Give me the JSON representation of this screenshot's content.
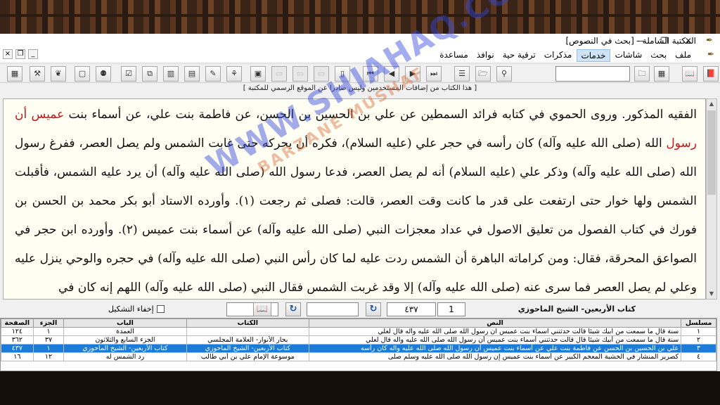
{
  "window": {
    "title": "المكتبة الشاملة - [بحث في النصوص]",
    "minimize": "—",
    "maximize": "❐",
    "close": "✕"
  },
  "menu": [
    "ملف",
    "بحث",
    "شاشات",
    "خدمات",
    "مذكرات",
    "ترقية حية",
    "نوافذ",
    "مساعدة"
  ],
  "menu_active": "خدمات",
  "notice": "[ هذا الكتاب من إضافات المستخدمين وليس صادرا عن الموقع الرسمي للمكتبة ]",
  "text": {
    "l1a": "الفقيه المذكور. وروى الحموي في كتابه فرائد السمطين عن علي بن الحسين بن الحسن، عن فاطمة بنت علي، عن أسماء بنت ",
    "l1b": "عميس أن",
    "l2a": "رسول",
    "l2b": " الله (صلى الله عليه وآله) كان رأسه في حجر علي (عليه السلام)، فكره أن يحركه حتى غابت الشمس ولم يصل العصر، ففرغ رسول",
    "l3": "الله (صلى الله عليه وآله) وذكر علي (عليه السلام) أنه لم يصل العصر، فدعا رسول الله (صلى الله عليه وآله) أن يرد عليه الشمس، فأقبلت",
    "l4": "الشمس ولها خوار حتى ارتفعت على قدر ما كانت وقت العصر، قالت: فصلى ثم رجعت (١). وأورده الاستاد أبو بكر محمد بن الحسن بن",
    "l5": "فورك في كتاب الفصول من تعليق الاصول في عداد معجزات النبي (صلى الله عليه وآله) عن أسماء بنت عميس (٢). وأورده ابن حجر في",
    "l6": "الصواعق المحرقة، فقال: ومن كراماته الباهرة أن الشمس ردت عليه لما كان رأس النبي (صلى الله عليه وآله) في حجره والوحي ينزل عليه",
    "l7": "وعلي لم يصل العصر فما سرى عنه (صلى الله عليه وآله) إلا وقد غربت الشمس فقال النبي (صلى الله عليه وآله) اللهم إنه كان في"
  },
  "nav": {
    "book": "كتاب الأربعين- الشيخ الماحوزي",
    "part": "1",
    "page": "٤٣٧",
    "hide_tashkeel": "إخفاء التشكيل"
  },
  "table": {
    "headers": [
      "مسلسل",
      "النص",
      "الكتاب",
      "الباب",
      "الجزء",
      "الصفحة"
    ],
    "rows": [
      [
        "١",
        "سنة قال ما سمعت من ابيك شيئا قالت حدثتني اسماء بنت عميس ان رسول الله صلى الله عليه وآله قال لعلي",
        "",
        "العمدة",
        "١",
        "١٢٤"
      ],
      [
        "٢",
        "سنة قال ما سمعت من أبيك شيئا قال قالت حدثتني أسماء بنت عميس أن رسول الله صلى الله عليه وآله قال لعلي",
        "بحار الأنوار- العلامة المجلسي",
        "الجزء السابع والثلاثون",
        "٣٧",
        "٣٦٢"
      ],
      [
        "٣",
        "علي بن الحسين بن الحسن عن فاطمة بنت علي عن أسماء بنت عميس أن رسول الله صلى الله عليه وآله كان رأسه",
        "كتاب الأربعين- الشيخ الماحوزي",
        "كتاب الأربعين- الشيخ الماحوزي",
        "١",
        "٤٣٧"
      ],
      [
        "٤",
        "كصرير المنشار في الخشبة المعجم الكبير عن أسماء بنت عميس إن رسول الله صلى الله عليه وسلم صلى",
        "موسوعة الإمام علي بن أبي طالب",
        "رد الشمس له",
        "١٢",
        "١٦"
      ]
    ],
    "selected_row": 2
  },
  "watermark": {
    "line1": "WWW.SHIAHAQ.COM",
    "line2": "BARZANE MUSHAF"
  },
  "colors": {
    "highlight_red": "#c01818",
    "selection_blue": "#1c7bd9",
    "text_bg": "#fefef2"
  }
}
